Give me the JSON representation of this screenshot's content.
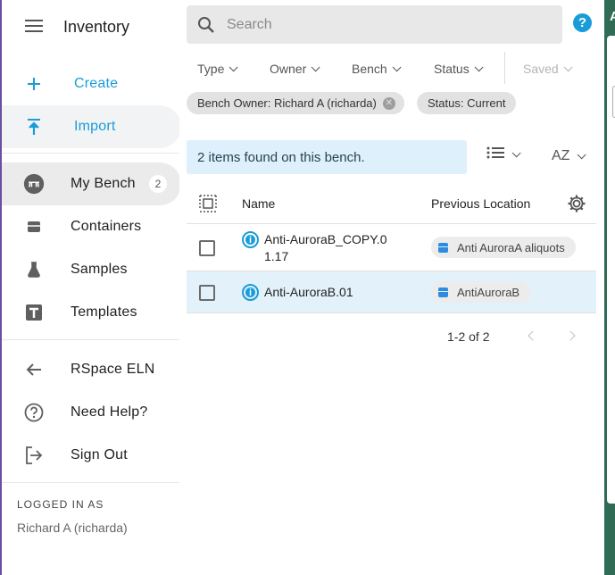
{
  "app": {
    "title": "Inventory"
  },
  "sidebar": {
    "actions": [
      {
        "label": "Create",
        "icon": "plus-icon"
      },
      {
        "label": "Import",
        "icon": "import-icon"
      }
    ],
    "nav": [
      {
        "label": "My Bench",
        "icon": "bench-icon",
        "count": "2"
      },
      {
        "label": "Containers",
        "icon": "container-icon"
      },
      {
        "label": "Samples",
        "icon": "flask-icon"
      },
      {
        "label": "Templates",
        "icon": "template-icon"
      }
    ],
    "links": [
      {
        "label": "RSpace ELN",
        "icon": "arrow-left-icon"
      },
      {
        "label": "Need Help?",
        "icon": "help-circle-icon"
      },
      {
        "label": "Sign Out",
        "icon": "sign-out-icon"
      }
    ],
    "logged_in_label": "LOGGED IN AS",
    "logged_in_user": "Richard A (richarda)"
  },
  "search": {
    "placeholder": "Search"
  },
  "filters": [
    {
      "label": "Type"
    },
    {
      "label": "Owner"
    },
    {
      "label": "Bench"
    },
    {
      "label": "Status"
    },
    {
      "label": "Saved"
    }
  ],
  "chips": [
    {
      "label": "Bench Owner: Richard A (richarda)"
    },
    {
      "label": "Status: Current"
    }
  ],
  "results": {
    "summary": "2 items found on this bench.",
    "sort_label": "AZ"
  },
  "table": {
    "columns": [
      "Name",
      "Previous Location"
    ],
    "rows": [
      {
        "name_line1": "Anti-AuroraB_COPY.0",
        "name_line2": "1.17",
        "location": "Anti AuroraA aliquots"
      },
      {
        "name_line1": "Anti-AuroraB.01",
        "name_line2": "",
        "location": "AntiAuroraB"
      }
    ]
  },
  "pagination": {
    "range": "1-2 of 2"
  },
  "right_panel": {
    "letter": "A"
  },
  "colors": {
    "accent": "#1a9cd8",
    "selected_row": "#e3f1fb",
    "info_bar": "#ddf0fb",
    "panel": "#2f6b55"
  }
}
